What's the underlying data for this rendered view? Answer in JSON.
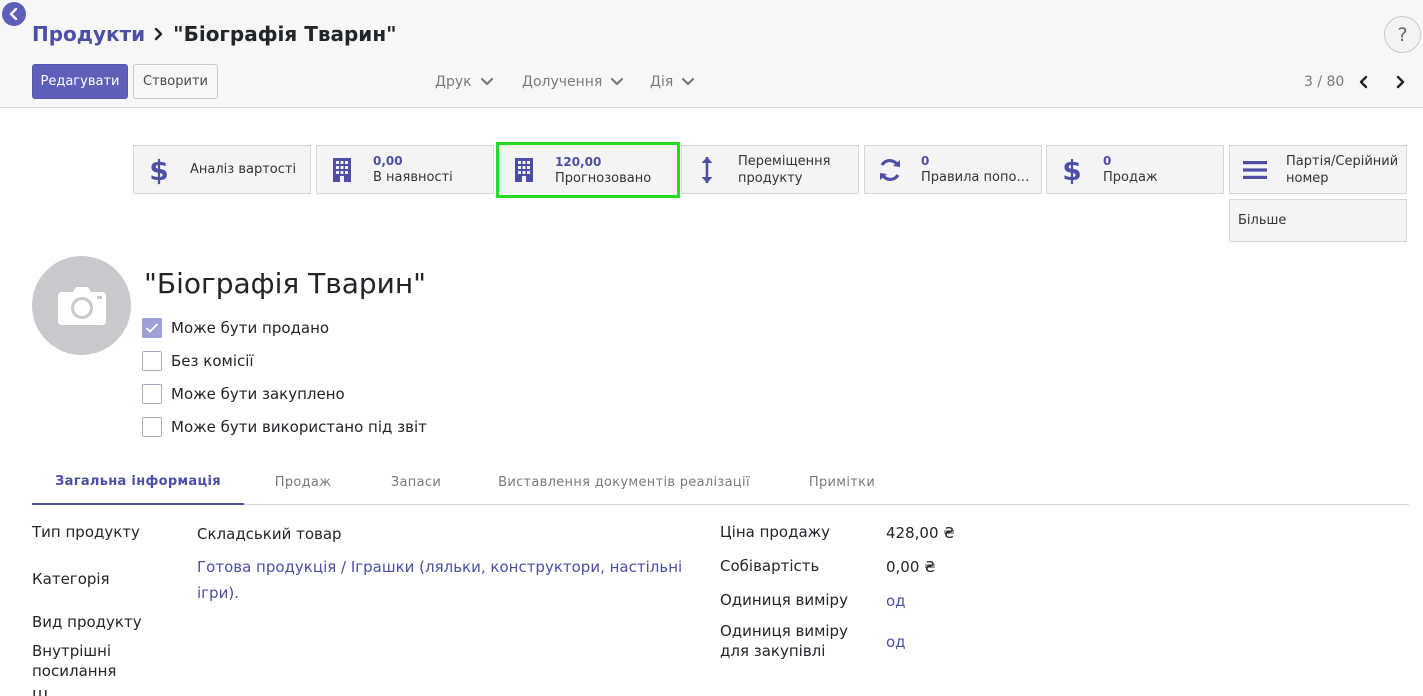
{
  "breadcrumb": {
    "parent": "Продукти",
    "current": "\"Біографія Тварин\""
  },
  "help_label": "?",
  "toolbar": {
    "edit_label": "Редагувати",
    "create_label": "Створити",
    "print_label": "Друк",
    "attach_label": "Долучення",
    "action_label": "Дія"
  },
  "pager": {
    "value": "3 / 80"
  },
  "smart_buttons": {
    "cost_analysis": {
      "label": "Аналіз вартості",
      "icon": "dollar-icon"
    },
    "on_hand": {
      "value": "0,00",
      "label": "В наявності",
      "icon": "building-icon"
    },
    "forecasted": {
      "value": "120,00",
      "label": "Прогнозовано",
      "icon": "building-icon"
    },
    "moves": {
      "label_line1": "Переміщення",
      "label_line2": "продукту",
      "icon": "arrows-vertical-icon"
    },
    "reorder": {
      "value": "0",
      "label": "Правила поповн...",
      "icon": "refresh-icon"
    },
    "sales": {
      "value": "0",
      "label": "Продаж",
      "icon": "dollar-icon"
    },
    "lots": {
      "label_line1": "Партія/Серійний",
      "label_line2": "номер",
      "icon": "list-icon"
    },
    "more_label": "Більше"
  },
  "product": {
    "title": "\"Біографія Тварин\"",
    "avatar_icon": "camera-icon",
    "options": [
      {
        "label": "Може бути продано",
        "checked": true
      },
      {
        "label": "Без комісії",
        "checked": false
      },
      {
        "label": "Може бути закуплено",
        "checked": false
      },
      {
        "label": "Може бути використано під звіт",
        "checked": false
      }
    ]
  },
  "tabs": [
    {
      "label": "Загальна інформація",
      "active": true
    },
    {
      "label": "Продаж",
      "active": false
    },
    {
      "label": "Запаси",
      "active": false
    },
    {
      "label": "Виставлення документів реалізації",
      "active": false
    },
    {
      "label": "Примітки",
      "active": false
    }
  ],
  "fields_left": {
    "product_type": {
      "label": "Тип продукту",
      "value": "Складський товар"
    },
    "category": {
      "label": "Категорія",
      "value_line1": "Готова продукція / Іграшки (ляльки, конструктори, настільні",
      "value_line2": "ігри)."
    },
    "product_kind": {
      "label": "Вид продукту"
    },
    "internal_ref": {
      "label_line1": "Внутрішні",
      "label_line2": "посилання"
    },
    "cut_label": "Ш..."
  },
  "fields_right": {
    "sale_price": {
      "label": "Ціна продажу",
      "value": "428,00 ₴"
    },
    "cost": {
      "label": "Собівартість",
      "value": "0,00 ₴"
    },
    "uom": {
      "label": "Одиниця виміру",
      "value": "од"
    },
    "purchase_uom": {
      "label_line1": "Одиниця виміру",
      "label_line2": "для закупівлі",
      "value": "од"
    }
  },
  "colors": {
    "brand": "#5d5fb8",
    "link": "#4c4fa5",
    "highlight": "#22dd22"
  }
}
